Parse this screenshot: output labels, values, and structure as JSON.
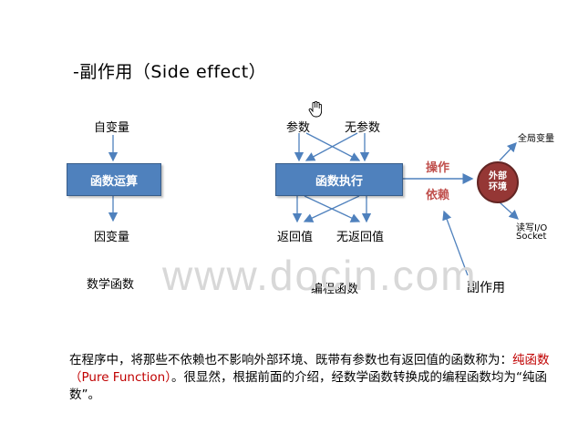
{
  "title": "-副作用（Side effect）",
  "left_diagram": {
    "input": "自变量",
    "box": "函数运算",
    "output": "因变量",
    "caption": "数学函数"
  },
  "right_diagram": {
    "inputs": [
      "参数",
      "无参数"
    ],
    "box": "函数执行",
    "outputs": [
      "返回值",
      "无返回值"
    ],
    "caption": "编程函数",
    "arrow_labels": [
      "操作",
      "依赖"
    ],
    "circle": [
      "外部",
      "环境"
    ],
    "targets": [
      "全局变量",
      "读写I/O",
      "Socket"
    ],
    "side_effect_label": "副作用"
  },
  "watermark": "www.docin.com",
  "paragraph": {
    "part1": "在程序中，将那些不依赖也不影响外部环境、既带有参数也有返回值的函数称为：",
    "highlight": "纯函数（Pure Function）",
    "part2": "。很显然，根据前面的介绍，经数学函数转换成的编程函数均为“纯函数”。"
  },
  "colors": {
    "box_fill": "#4f81bd",
    "circle_fill": "#953735",
    "highlight_text": "#c0504d",
    "arrow": "#4f81bd"
  }
}
